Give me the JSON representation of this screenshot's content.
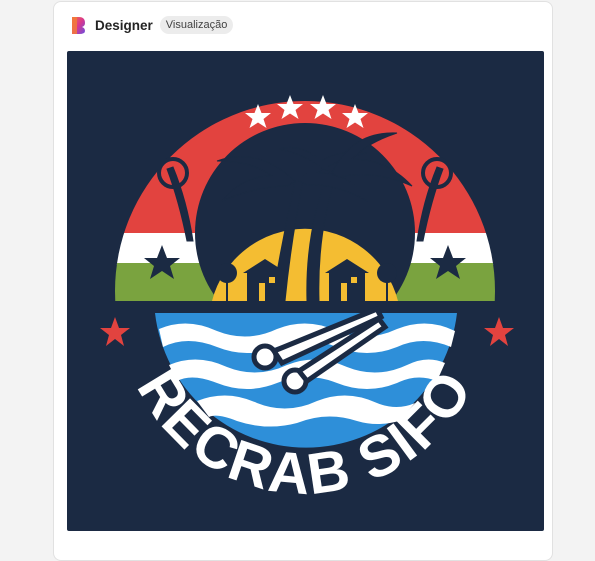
{
  "header": {
    "app_name": "Designer",
    "badge": "Visualização",
    "logo_icon": "designer-logo-icon"
  },
  "image": {
    "logo_text": "RECRAB SIFO",
    "colors": {
      "background": "#1b2a43",
      "red": "#e2433f",
      "sun": "#f4bd32",
      "green": "#7aa33f",
      "white": "#ffffff",
      "water_blue": "#2e8fd9",
      "dark": "#1b2a43"
    }
  }
}
